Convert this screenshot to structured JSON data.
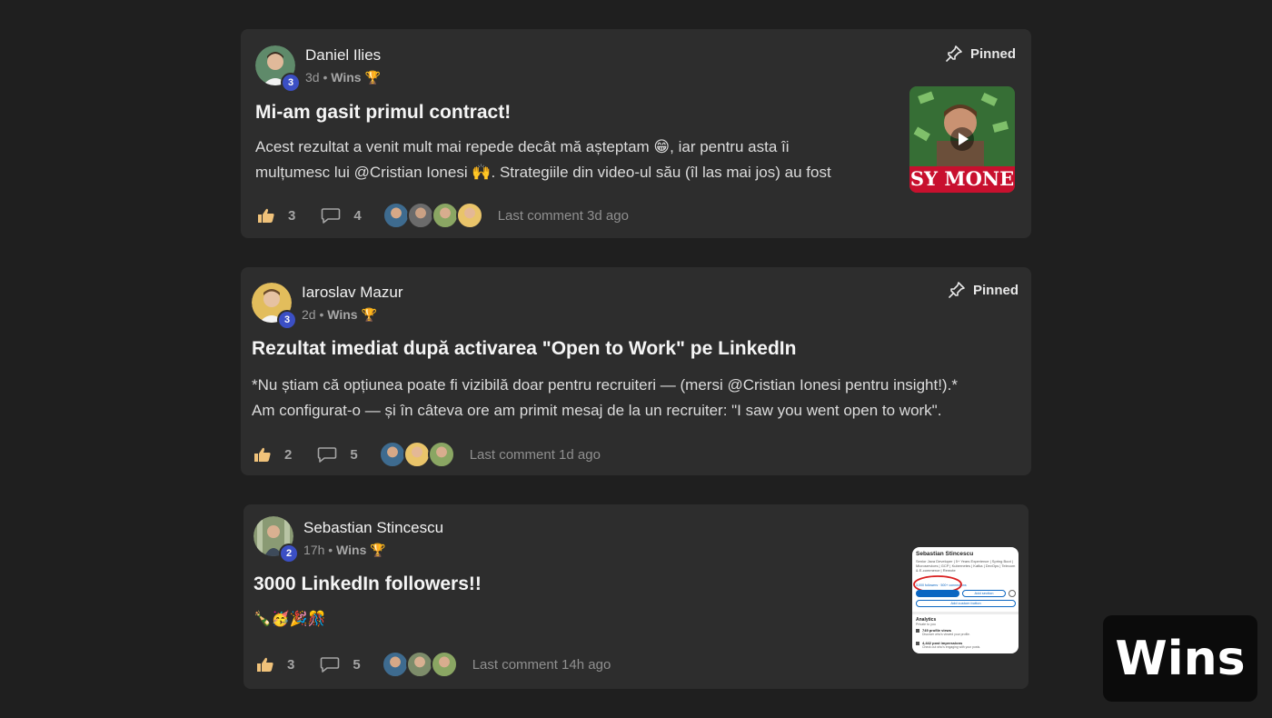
{
  "pinned_label": "Pinned",
  "overlay_label": "Wins",
  "posts": [
    {
      "author": "Daniel Ilies",
      "level": "3",
      "time": "3d",
      "category": "Wins",
      "category_emoji": "🏆",
      "pinned": true,
      "title": "Mi-am gasit primul contract!",
      "body_lines": [
        "Acest rezultat a venit mult mai repede decât mă așteptam 😁, iar pentru asta îi",
        "mulțumesc lui @Cristian Ionesi 🙌. Strategiile din video-ul său (îl las mai jos) au fost"
      ],
      "likes": "3",
      "comments": "4",
      "last_comment": "Last comment 3d ago",
      "thumbnail_caption": "SY MONE",
      "avatar_color": "#6a8f6e"
    },
    {
      "author": "Iaroslav Mazur",
      "level": "3",
      "time": "2d",
      "category": "Wins",
      "category_emoji": "🏆",
      "pinned": true,
      "title": "Rezultat imediat după activarea \"Open to Work\" pe LinkedIn",
      "body_lines": [
        "*Nu știam că opțiunea poate fi vizibilă doar pentru recruiteri — (mersi @Cristian Ionesi pentru insight!).*",
        "Am configurat-o — și în câteva ore am primit mesaj de la un recruiter: \"I saw you went open to work\"."
      ],
      "likes": "2",
      "comments": "5",
      "last_comment": "Last comment 1d ago",
      "avatar_color": "#d9b45a"
    },
    {
      "author": "Sebastian Stincescu",
      "level": "2",
      "time": "17h",
      "category": "Wins",
      "category_emoji": "🏆",
      "pinned": false,
      "title": "3000 LinkedIn followers!!",
      "body_lines": [
        "🍾🥳🎉🎊"
      ],
      "likes": "3",
      "comments": "5",
      "last_comment": "Last comment 14h ago",
      "avatar_color": "#7d8c6a",
      "thumbnail": {
        "name": "Sebastian Stincescu",
        "headline": "Senior Java Developer | 5+ Years Experience | Spring Boot | Microservices | GCP | Kubernetes | Kafka | DevOps | Telecom & E-commerce | Remote",
        "followers": "3,000 followers · 500+ connections",
        "add_section": "Add section",
        "custom_button": "Add custom button",
        "analytics": "Analytics",
        "private": "Private to you",
        "views": "749 profile views",
        "views_sub": "Discover who's viewed your profile.",
        "impressions": "4,442 post impressions",
        "impressions_sub": "Check out who's engaging with your posts."
      }
    }
  ]
}
